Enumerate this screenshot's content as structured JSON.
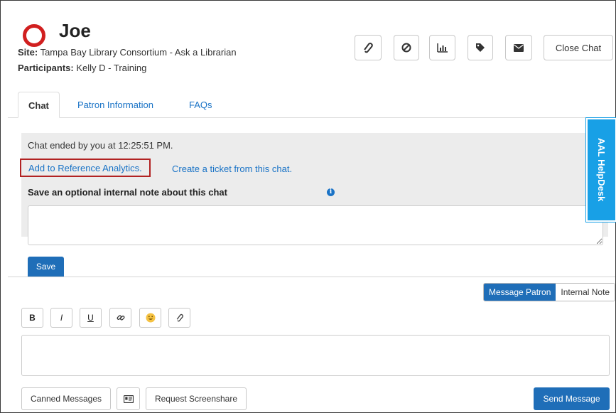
{
  "header": {
    "patron_name": "Joe",
    "site_label": "Site:",
    "site_value": "Tampa Bay Library Consortium - Ask a Librarian",
    "participants_label": "Participants:",
    "participants_value": "Kelly D - Training",
    "status_color": "#d11f1f"
  },
  "toolbar": {
    "icons": [
      "paperclip-icon",
      "ban-icon",
      "bar-chart-icon",
      "tag-icon",
      "envelope-icon"
    ],
    "close_label": "Close Chat"
  },
  "tabs": [
    {
      "label": "Chat",
      "active": true
    },
    {
      "label": "Patron Information",
      "active": false
    },
    {
      "label": "FAQs",
      "active": false
    }
  ],
  "ended": {
    "message": "Chat ended by you at 12:25:51 PM.",
    "analytics_link": "Add to Reference Analytics.",
    "ticket_link": "Create a ticket from this chat.",
    "note_label": "Save an optional internal note about this chat",
    "note_value": "",
    "save_label": "Save"
  },
  "message_mode": {
    "patron_label": "Message Patron",
    "internal_label": "Internal Note",
    "selected": "Message Patron"
  },
  "format_toolbar": [
    "B",
    "I",
    "U",
    "link-icon",
    "emoji-icon",
    "paperclip-icon"
  ],
  "compose": {
    "value": ""
  },
  "bottom": {
    "canned_label": "Canned Messages",
    "card_icon": "id-card-icon",
    "screenshare_label": "Request Screenshare",
    "send_label": "Send Message"
  },
  "helpdesk": {
    "label": "AAL HelpDesk"
  },
  "colors": {
    "accent": "#1f6eb8",
    "link": "#1a73c6",
    "helpdesk": "#18a0e6",
    "highlight_border": "#b22222"
  }
}
